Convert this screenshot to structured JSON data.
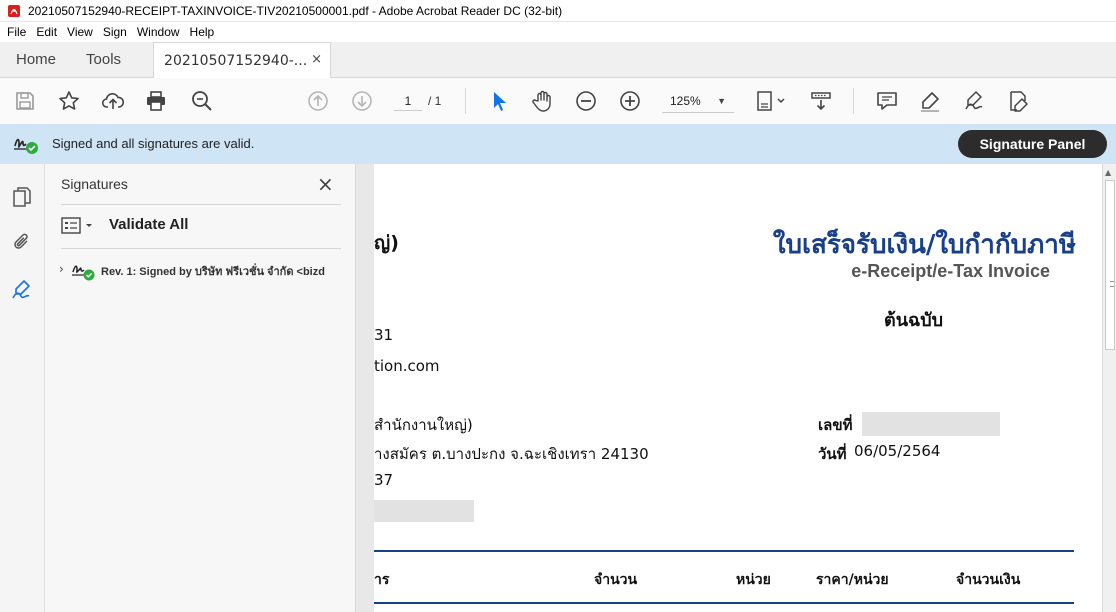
{
  "window": {
    "title": "20210507152940-RECEIPT-TAXINVOICE-TIV20210500001.pdf - Adobe Acrobat Reader DC (32-bit)"
  },
  "menu": [
    "File",
    "Edit",
    "View",
    "Sign",
    "Window",
    "Help"
  ],
  "tabs": {
    "home": "Home",
    "tools": "Tools",
    "document": "20210507152940-...",
    "close": "×"
  },
  "toolbar": {
    "page_current": "1",
    "page_total": "/ 1",
    "zoom": "125%"
  },
  "signature_bar": {
    "message": "Signed and all signatures are valid.",
    "panel_button": "Signature Panel"
  },
  "signatures_panel": {
    "title": "Signatures",
    "close": "×",
    "validate_all": "Validate All",
    "revision": "Rev. 1: Signed by บริษัท ฟรีเวชั่น จำกัด <bizd"
  },
  "document": {
    "title_th": "ใบเสร็จรับเงิน/ใบกำกับภาษี",
    "title_en": "e-Receipt/e-Tax Invoice",
    "original": "ต้นฉบับ",
    "line_1": "ญ่)",
    "line_2": "31",
    "line_3": "tion.com",
    "line_4": "สำนักงานใหญ่)",
    "line_5": "างสมัคร ต.บางปะกง จ.ฉะเชิงเทรา 24130",
    "line_6": "37",
    "doc_no_label": "เลขที่",
    "date_label": "วันที่",
    "date_value": "06/05/2564",
    "table_headers": [
      "าร",
      "จำนวน",
      "หน่วย",
      "ราคา/หน่วย",
      "จำนวนเงิน"
    ]
  },
  "colors": {
    "accent_blue": "#1a3f8a",
    "signature_bar": "#cfe4f5",
    "valid_green": "#2eaa3f",
    "cursor_blue": "#1473e6"
  }
}
